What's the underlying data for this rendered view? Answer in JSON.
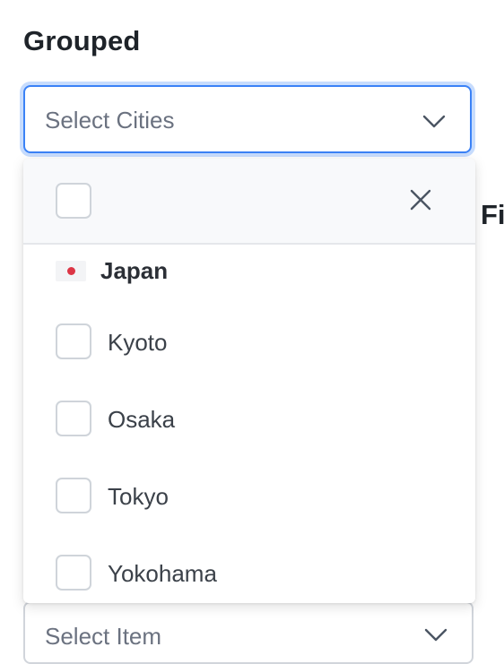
{
  "section": {
    "title": "Grouped",
    "side_title_partial": "Fi"
  },
  "cities_select": {
    "placeholder": "Select Cities",
    "state": "open",
    "icon": "chevron-down-icon"
  },
  "panel": {
    "close_icon": "close-icon",
    "groups": [
      {
        "label": "Japan",
        "flag_icon": "japan-flag-icon",
        "options": [
          {
            "label": "Kyoto",
            "checked": false
          },
          {
            "label": "Osaka",
            "checked": false
          },
          {
            "label": "Tokyo",
            "checked": false
          },
          {
            "label": "Yokohama",
            "checked": false
          }
        ]
      }
    ]
  },
  "item_select": {
    "placeholder": "Select Item",
    "icon": "chevron-down-icon"
  },
  "colors": {
    "focus_border": "#3b82f6",
    "focus_ring": "#c7dcfd",
    "flag_red": "#dc3545"
  }
}
